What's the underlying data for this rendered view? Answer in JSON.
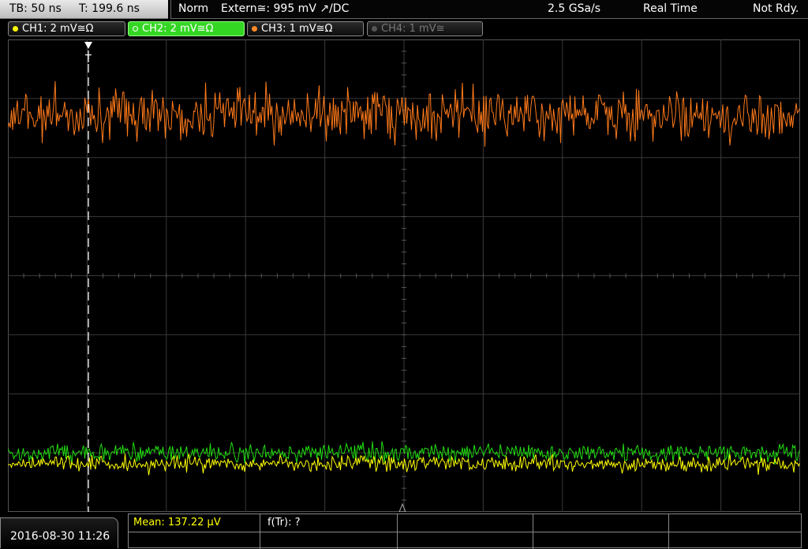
{
  "topbar": {
    "timebase": "TB: 50 ns",
    "trigger_time": "T: 199.6 ns",
    "trigger_mode": "Norm",
    "trigger_source": "Extern≅: 995 mV ↗/DC",
    "sample_rate": "2.5 GSa/s",
    "acq_mode": "Real Time",
    "status": "Not Rdy."
  },
  "channels": [
    {
      "id": "CH1",
      "label": "CH1: 2 mV≅Ω",
      "color": "#ffff00",
      "active": false,
      "enabled": true
    },
    {
      "id": "CH2",
      "label": "CH2: 2 mV≅Ω",
      "color": "#33dd22",
      "active": true,
      "enabled": true
    },
    {
      "id": "CH3",
      "label": "CH3: 1 mV≅Ω",
      "color": "#ff8a2a",
      "active": false,
      "enabled": true
    },
    {
      "id": "CH4",
      "label": "CH4: 1 mV≅",
      "color": "#777777",
      "active": false,
      "enabled": false
    }
  ],
  "trigger_marker": "T",
  "colors": {
    "grid": "#3a3a3a",
    "ch1_trace": "#ffff00",
    "ch2_trace": "#22dd11",
    "ch3_trace": "#ff7a1a",
    "background": "#000000"
  },
  "measurements": {
    "mean": "Mean: 137.22 µV",
    "rise_freq": "f(Tr): ?"
  },
  "datetime": "2016-08-30 11:26"
}
